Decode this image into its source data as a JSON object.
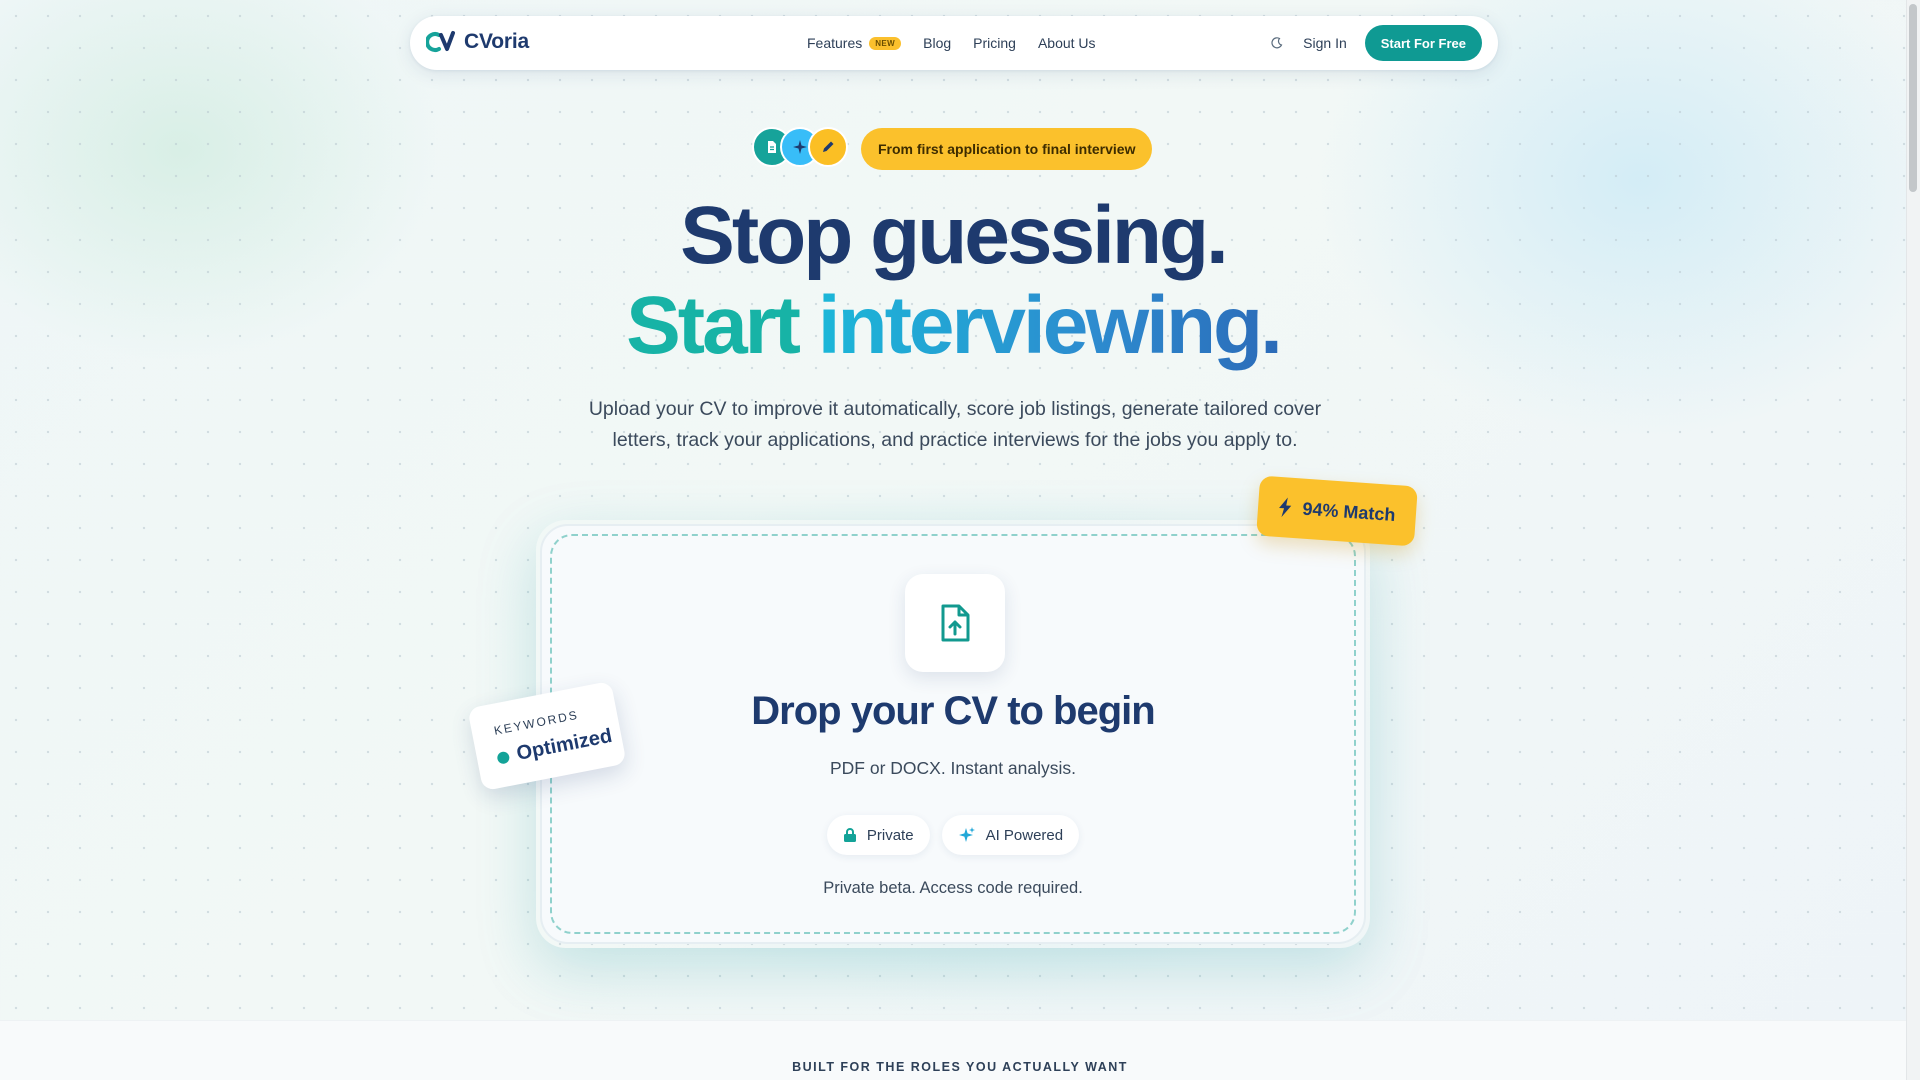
{
  "nav": {
    "brand": "CVoria",
    "links": [
      {
        "label": "Features",
        "badge": "NEW"
      },
      {
        "label": "Blog"
      },
      {
        "label": "Pricing"
      },
      {
        "label": "About Us"
      }
    ],
    "signin": "Sign In",
    "cta": "Start For Free",
    "icons": {
      "theme_toggle": "moon-icon"
    }
  },
  "hero": {
    "tagline": "From first application to final interview",
    "icons": [
      "document-icon",
      "sparkle-icon",
      "pen-icon"
    ],
    "headline_line1": "Stop guessing.",
    "headline_line2_a": "Start",
    "headline_line2_b": "interviewing.",
    "subcopy": "Upload your CV to improve it automatically, score job listings, generate tailored cover letters, track your applications, and practice interviews for the jobs you apply to."
  },
  "upload": {
    "title": "Drop your CV to begin",
    "subtitle": "PDF or DOCX. Instant analysis.",
    "chips": [
      {
        "label": "Private",
        "icon": "lock-icon"
      },
      {
        "label": "AI Powered",
        "icon": "sparkle-icon"
      }
    ],
    "note": "Private beta. Access code required."
  },
  "floating": {
    "match": "94% Match",
    "keywords_label": "KEYWORDS",
    "keywords_value": "Optimized"
  },
  "section": {
    "heading": "BUILT FOR THE ROLES YOU ACTUALLY WANT"
  },
  "colors": {
    "brand_navy": "#1e3a6e",
    "brand_teal": "#0f9a93",
    "accent_yellow": "#fbc12c"
  }
}
